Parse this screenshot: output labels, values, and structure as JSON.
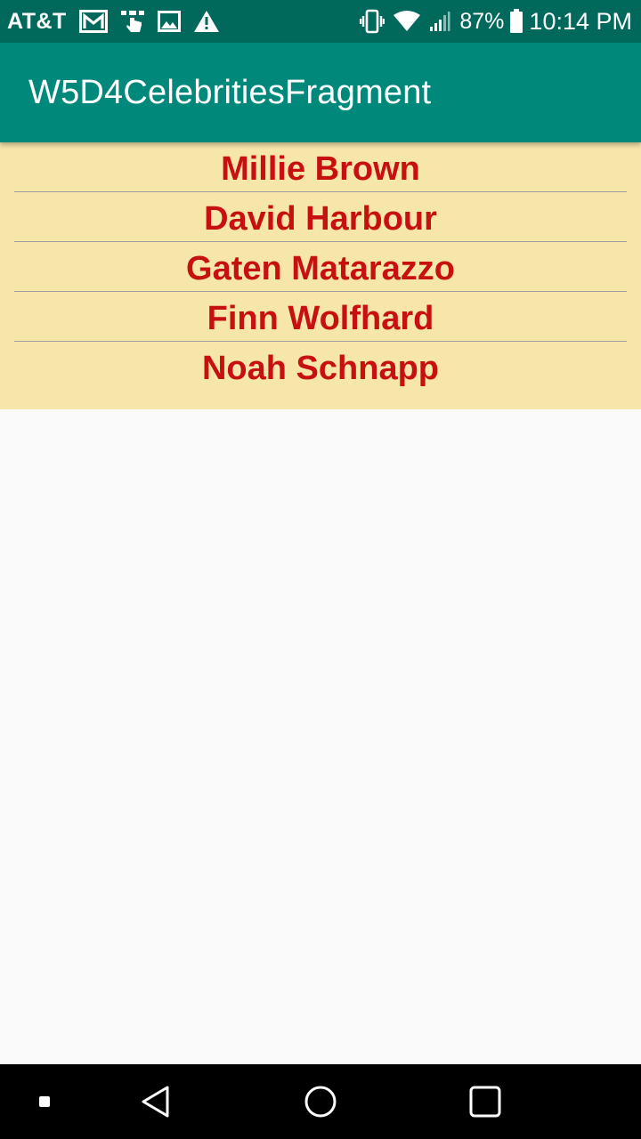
{
  "status_bar": {
    "carrier": "AT&T",
    "battery_percent": "87%",
    "time": "10:14 PM",
    "left_icons": [
      "gmail-icon",
      "touch-icon",
      "image-icon",
      "warning-icon"
    ],
    "right_icons": [
      "vibrate-icon",
      "wifi-icon",
      "signal-icon",
      "battery-icon"
    ]
  },
  "app_bar": {
    "title": "W5D4CelebritiesFragment",
    "color": "#00897b"
  },
  "celebrities": {
    "items": [
      "Millie Brown",
      "David Harbour",
      "Gaten Matarazzo",
      "Finn Wolfhard",
      "Noah Schnapp"
    ],
    "text_color": "#c71010",
    "background": "#f7e6aa"
  },
  "nav_bar": {
    "buttons": [
      "back-icon",
      "home-icon",
      "recents-icon"
    ]
  }
}
